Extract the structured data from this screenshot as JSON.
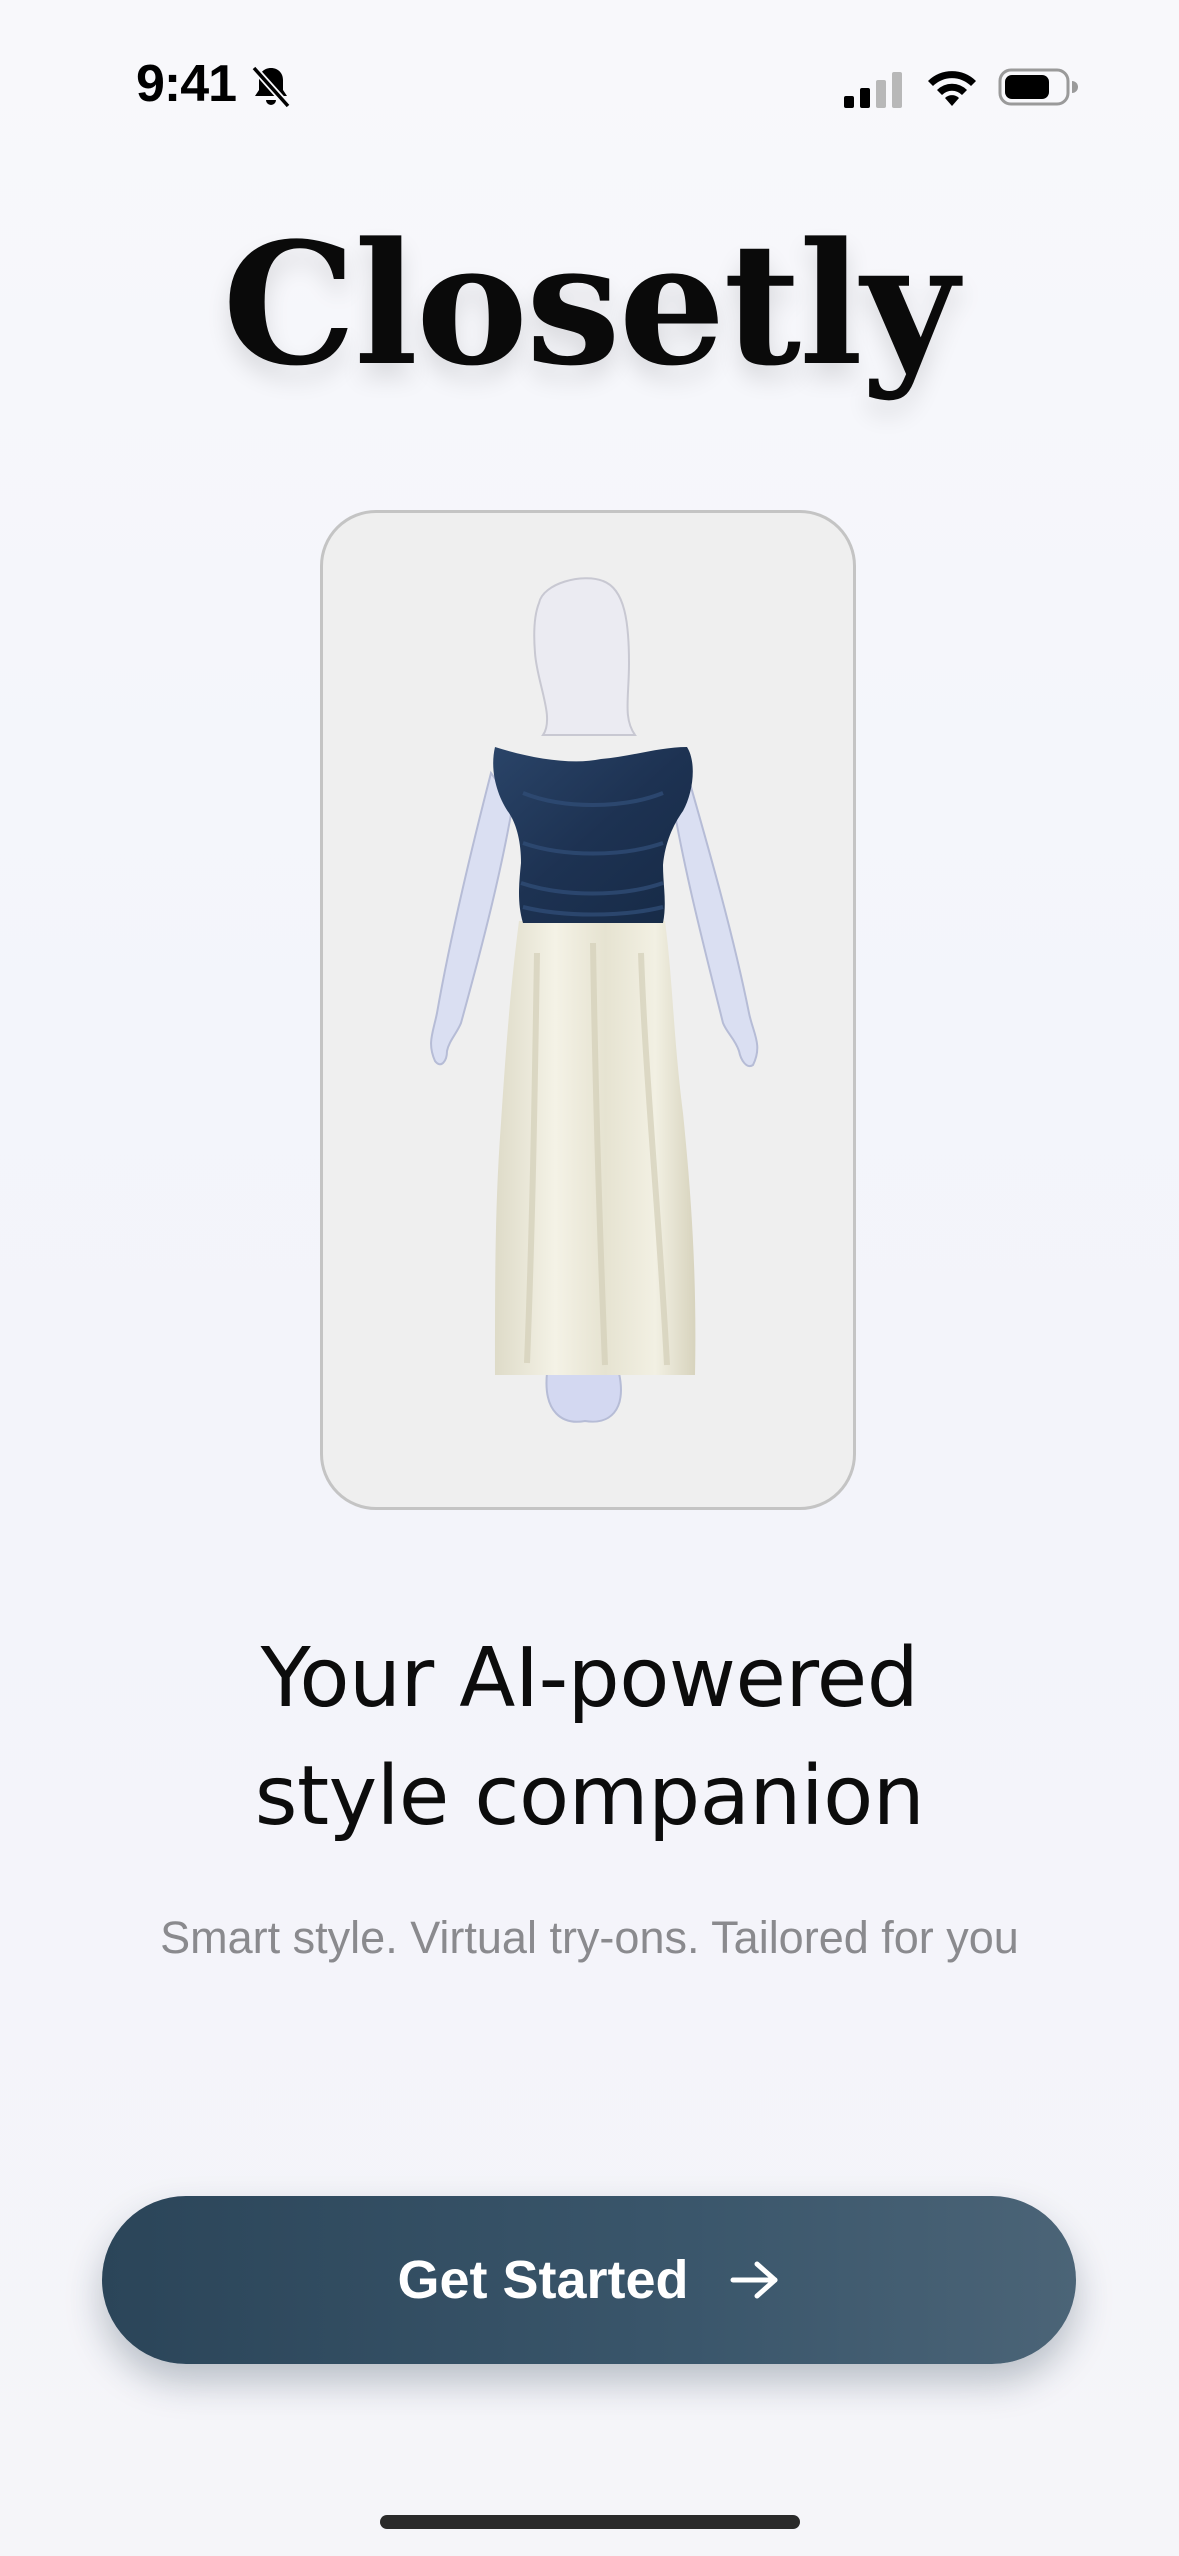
{
  "status_bar": {
    "time": "9:41",
    "icons": [
      "bell-slash-icon",
      "cellular-signal-icon",
      "wifi-icon",
      "battery-icon"
    ]
  },
  "app": {
    "title": "Closetly"
  },
  "preview": {
    "figure": "avatar-outfit-preview",
    "top_color": "#1f3553",
    "skirt_color": "#ece9da",
    "silhouette_color": "#dadff2"
  },
  "headline": {
    "line1": "Your AI-powered",
    "line2": "style companion"
  },
  "tagline": "Smart style. Virtual try-ons. Tailored for you",
  "cta": {
    "label": "Get Started",
    "icon": "arrow-right-icon",
    "color": "#2f4a5f"
  }
}
